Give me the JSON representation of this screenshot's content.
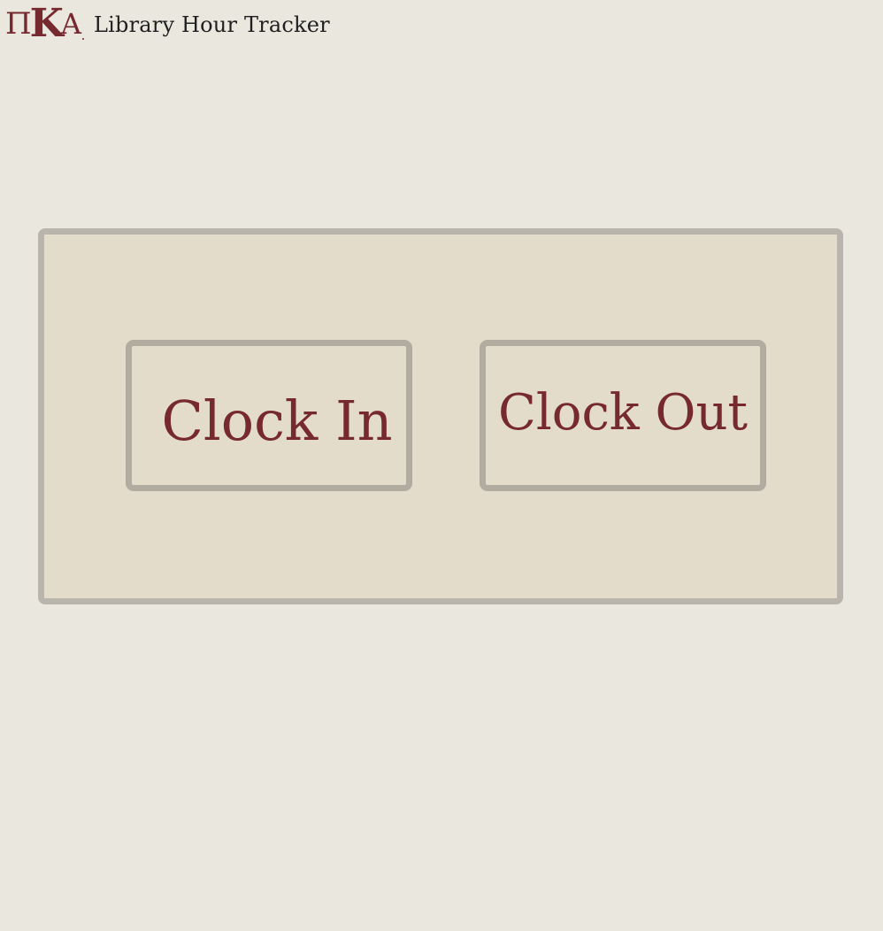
{
  "header": {
    "logo": {
      "glyph_1": "Π",
      "glyph_2": "K",
      "glyph_3": "A",
      "color": "#762a30"
    },
    "app_title": "Library Hour Tracker"
  },
  "main": {
    "clock_in_label": "Clock In",
    "clock_out_label": "Clock Out"
  },
  "colors": {
    "background": "#eae7df",
    "panel": "#e3dccb",
    "border": "#b9b4ac",
    "accent": "#762a30"
  }
}
